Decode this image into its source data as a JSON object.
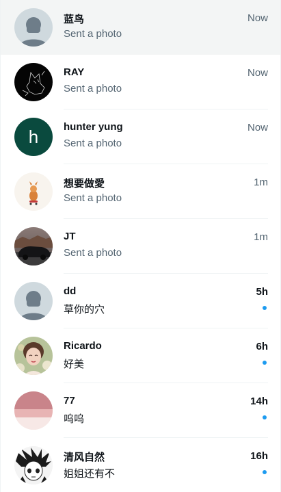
{
  "colors": {
    "accent": "#1d9bf0",
    "selected_bg": "#f3f5f5",
    "secondary_text": "#536471",
    "primary_text": "#0f1419"
  },
  "conversations": [
    {
      "name": "蓝鸟",
      "preview": "Sent a photo",
      "time": "Now",
      "unread": false,
      "avatar": "default-avatar-icon"
    },
    {
      "name": "RAY",
      "preview": "Sent a photo",
      "time": "Now",
      "unread": false,
      "avatar": "black-line-art-avatar"
    },
    {
      "name": "hunter yung",
      "preview": "Sent a photo",
      "time": "Now",
      "unread": false,
      "avatar": "letter-avatar",
      "avatar_letter": "h"
    },
    {
      "name": "想要做愛",
      "preview": "Sent a photo",
      "time": "1m",
      "unread": false,
      "avatar": "illustration-avatar"
    },
    {
      "name": "JT",
      "preview": "Sent a photo",
      "time": "1m",
      "unread": false,
      "avatar": "car-photo-avatar"
    },
    {
      "name": "dd",
      "preview": "草你的穴",
      "time": "5h",
      "unread": true,
      "avatar": "default-avatar-icon"
    },
    {
      "name": "Ricardo",
      "preview": "好美",
      "time": "6h",
      "unread": true,
      "avatar": "portrait-avatar"
    },
    {
      "name": "77",
      "preview": "呜呜",
      "time": "14h",
      "unread": true,
      "avatar": "pink-photo-avatar"
    },
    {
      "name": "清风自然",
      "preview": "姐姐还有不",
      "time": "16h",
      "unread": true,
      "avatar": "manga-avatar"
    }
  ]
}
